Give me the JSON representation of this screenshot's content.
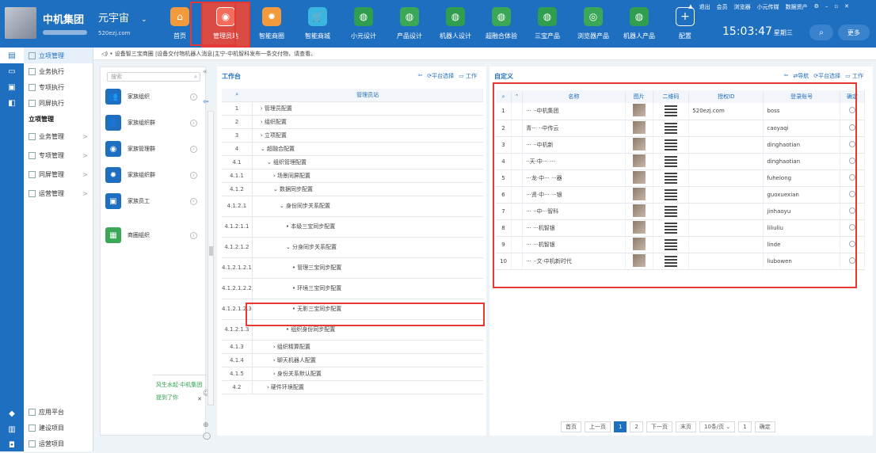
{
  "top": {
    "brand": "中机集团",
    "workspace": "元宇宙",
    "workspace_caret": "⌄",
    "site": "520ezj.com",
    "modules": [
      {
        "label": "首页",
        "icon": "home-icon",
        "glyph": "⌂",
        "style": "orange"
      },
      {
        "label": "管理员站",
        "icon": "admin-station-icon",
        "glyph": "◉",
        "style": "red",
        "active": true
      },
      {
        "label": "智能商圈",
        "icon": "smart-business-icon",
        "glyph": "✹",
        "style": "orange"
      },
      {
        "label": "智能商城",
        "icon": "cart-icon",
        "glyph": "🛒",
        "style": "cyan"
      },
      {
        "label": "小元设计",
        "icon": "design-globe-icon",
        "glyph": "◍",
        "style": "green"
      },
      {
        "label": "产品设计",
        "icon": "product-design-icon",
        "glyph": "◍",
        "style": "green2"
      },
      {
        "label": "机器人设计",
        "icon": "robot-design-icon",
        "glyph": "◍",
        "style": "green"
      },
      {
        "label": "超融合体验",
        "icon": "hyper-fusion-icon",
        "glyph": "◍",
        "style": "green2"
      },
      {
        "label": "三宝产品",
        "icon": "sanbao-product-icon",
        "glyph": "◍",
        "style": "green"
      },
      {
        "label": "浏览器产品",
        "icon": "browser-product-icon",
        "glyph": "◎",
        "style": "green2"
      },
      {
        "label": "机器人产品",
        "icon": "robot-product-icon",
        "glyph": "◍",
        "style": "green"
      },
      {
        "label": "配置",
        "icon": "plus-config-icon",
        "glyph": "+",
        "style": "white"
      }
    ],
    "links": [
      "▲",
      "退出",
      "会员",
      "浏览器",
      "小元传媒",
      "数据资产",
      "⚙",
      "–",
      "▫",
      "✕"
    ],
    "time": "15:03:47",
    "weekday": "星期三",
    "search_icon": "⌕",
    "more": "更多"
  },
  "notice": "◁) • 设备智三宝商圈 |设备交付物机器人消息|主宁-中机智科发布一条交付物，请查看。",
  "sidenav": [
    {
      "label": "立项管理",
      "active": true
    },
    {
      "label": "业务执行"
    },
    {
      "label": "专项执行"
    },
    {
      "label": "同屏执行"
    },
    {
      "label": "立项管理",
      "head": true
    },
    {
      "label": "业务管理",
      "arrow": ">",
      "sub": true
    },
    {
      "label": "专项管理",
      "arrow": ">",
      "sub": true
    },
    {
      "label": "同屏管理",
      "arrow": ">",
      "sub": true
    },
    {
      "label": "运营管理",
      "arrow": ">",
      "sub": true
    }
  ],
  "sidenav_bottom": [
    "应用平台",
    "建设项目",
    "运营项目"
  ],
  "org": {
    "search_placeholder": "搜索",
    "items": [
      {
        "label": "家族组织",
        "icon": "org-people-icon",
        "glyph": "👥"
      },
      {
        "label": "家族组织群",
        "icon": "org-group-icon",
        "glyph": "👤"
      },
      {
        "label": "家族管理群",
        "icon": "org-manage-icon",
        "glyph": "◉"
      },
      {
        "label": "家族组织群",
        "icon": "org-cloud-icon",
        "glyph": "✹"
      },
      {
        "label": "家族员工",
        "icon": "staff-icon",
        "glyph": "▣"
      },
      {
        "label": "商圈组织",
        "icon": "business-org-icon",
        "glyph": "▦",
        "green": true
      }
    ],
    "chat_text": "风生水起·中机集团",
    "chat_link": "提到了你",
    "chat_close": "✕"
  },
  "work": {
    "title": "工作台",
    "tools": [
      "⇦",
      "⟳平台选择",
      "▭ 工作"
    ],
    "header": "管理员站",
    "rows": [
      {
        "no": "1",
        "label": "› 管理员配置",
        "indent": 0
      },
      {
        "no": "2",
        "label": "› 组织配置",
        "indent": 0
      },
      {
        "no": "3",
        "label": "› 立项配置",
        "indent": 0
      },
      {
        "no": "4",
        "label": "⌄ 超融合配置",
        "indent": 0
      },
      {
        "no": "4.1",
        "label": "⌄ 组织管理配置",
        "indent": 1
      },
      {
        "no": "4.1.1",
        "label": "› 场景同屏配置",
        "indent": 2
      },
      {
        "no": "4.1.2",
        "label": "⌄ 数据同步配置",
        "indent": 2
      },
      {
        "no": "4.1.2.1",
        "label": "⌄ 身份同步关系配置",
        "indent": 3
      },
      {
        "no": "4.1.2.1.1",
        "label": "• 本级三宝同步配置",
        "indent": 4
      },
      {
        "no": "4.1.2.1.2",
        "label": "⌄ 分身同步关系配置",
        "indent": 4
      },
      {
        "no": "4.1.2.1.2.1",
        "label": "• 管理三宝同步配置",
        "indent": 5
      },
      {
        "no": "4.1.2.1.2.2",
        "label": "• 环境三宝同步配置",
        "indent": 5
      },
      {
        "no": "4.1.2.1.2.3",
        "label": "• 无影三宝同步配置",
        "indent": 5
      },
      {
        "no": "4.1.2.1.3",
        "label": "• 组织身份同步配置",
        "indent": 4
      },
      {
        "no": "4.1.3",
        "label": "› 组织精算配置",
        "indent": 2
      },
      {
        "no": "4.1.4",
        "label": "› 聊天机器人配置",
        "indent": 2
      },
      {
        "no": "4.1.5",
        "label": "› 身份关系默认配置",
        "indent": 2
      },
      {
        "no": "4.2",
        "label": "› 硬件环境配置",
        "indent": 1
      }
    ]
  },
  "custom": {
    "title": "自定义",
    "tools": [
      "⇦",
      "⇄导航",
      "⟳平台选择",
      "▭ 工作"
    ],
    "headers": [
      "⌕",
      "⌃",
      "名称",
      "图片",
      "二维码",
      "授权ID",
      "登录账号",
      "确定"
    ],
    "rows": [
      {
        "no": "1",
        "name": "··· ··中机集团",
        "auth": "520ezj.com",
        "login": "boss"
      },
      {
        "no": "2",
        "name": "青··· ··中传云",
        "auth": "",
        "login": "caoyaqi"
      },
      {
        "no": "3",
        "name": "··· ··中机新",
        "auth": "",
        "login": "dinghaotian"
      },
      {
        "no": "4",
        "name": "··天·中··· ···",
        "auth": "",
        "login": "dinghaotian"
      },
      {
        "no": "5",
        "name": "···龙·中··· ···器",
        "auth": "",
        "login": "fuhelong"
      },
      {
        "no": "6",
        "name": "···贤·中··· ···银",
        "auth": "",
        "login": "guoxuexian"
      },
      {
        "no": "7",
        "name": "··· ··中···智科",
        "auth": "",
        "login": "jinhaoyu"
      },
      {
        "no": "8",
        "name": "··· ···机智银",
        "auth": "",
        "login": "liliuliu"
      },
      {
        "no": "9",
        "name": "··· ···机智银",
        "auth": "",
        "login": "linde"
      },
      {
        "no": "10",
        "name": "··· ··文·中机新时代",
        "auth": "",
        "login": "liubowen"
      }
    ],
    "pager": [
      "首页",
      "上一页",
      "1",
      "2",
      "下一页",
      "末页",
      "10条/页 ⌄",
      "1",
      "确定"
    ]
  },
  "colors": {
    "accent": "#1f6fc0",
    "highlight_box": "#e53935"
  }
}
